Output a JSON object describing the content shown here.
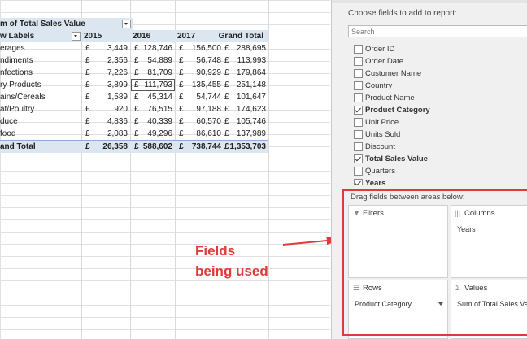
{
  "pivot": {
    "header_label": "m of Total Sales Value",
    "row_labels_header": "w Labels",
    "columns": [
      "2015",
      "2016",
      "2017",
      "Grand Total"
    ],
    "currency": "£",
    "rows": [
      {
        "label": "erages",
        "values": [
          "3,449",
          "128,746",
          "156,500",
          "288,695"
        ]
      },
      {
        "label": "ndiments",
        "values": [
          "2,356",
          "54,889",
          "56,748",
          "113,993"
        ]
      },
      {
        "label": "nfections",
        "values": [
          "7,226",
          "81,709",
          "90,929",
          "179,864"
        ]
      },
      {
        "label": "ry Products",
        "values": [
          "3,899",
          "111,793",
          "135,455",
          "251,148"
        ]
      },
      {
        "label": "ains/Cereals",
        "values": [
          "1,589",
          "45,314",
          "54,744",
          "101,647"
        ]
      },
      {
        "label": "at/Poultry",
        "values": [
          "920",
          "76,515",
          "97,188",
          "174,623"
        ]
      },
      {
        "label": "duce",
        "values": [
          "4,836",
          "40,339",
          "60,570",
          "105,746"
        ]
      },
      {
        "label": "food",
        "values": [
          "2,083",
          "49,296",
          "86,610",
          "137,989"
        ]
      }
    ],
    "total": {
      "label": "and Total",
      "values": [
        "26,358",
        "588,602",
        "738,744",
        "1,353,703"
      ]
    }
  },
  "callout": {
    "line1": "Fields",
    "line2": "being used",
    "color": "#e03a3a"
  },
  "pane": {
    "hint": "Choose fields to add to report:",
    "search_placeholder": "Search",
    "fields": [
      {
        "label": "Order ID",
        "checked": false
      },
      {
        "label": "Order Date",
        "checked": false
      },
      {
        "label": "Customer Name",
        "checked": false
      },
      {
        "label": "Country",
        "checked": false
      },
      {
        "label": "Product Name",
        "checked": false
      },
      {
        "label": "Product Category",
        "checked": true
      },
      {
        "label": "Unit Price",
        "checked": false
      },
      {
        "label": "Units Sold",
        "checked": false
      },
      {
        "label": "Discount",
        "checked": false
      },
      {
        "label": "Total Sales Value",
        "checked": true
      },
      {
        "label": "Quarters",
        "checked": false
      },
      {
        "label": "Years",
        "checked": true
      }
    ],
    "drag_hint": "Drag fields between areas below:",
    "areas": {
      "filters": {
        "title": "Filters",
        "chip": ""
      },
      "columns": {
        "title": "Columns",
        "chip": "Years"
      },
      "rows": {
        "title": "Rows",
        "chip": "Product Category"
      },
      "values": {
        "title": "Values",
        "chip": "Sum of Total Sales Va"
      }
    }
  }
}
